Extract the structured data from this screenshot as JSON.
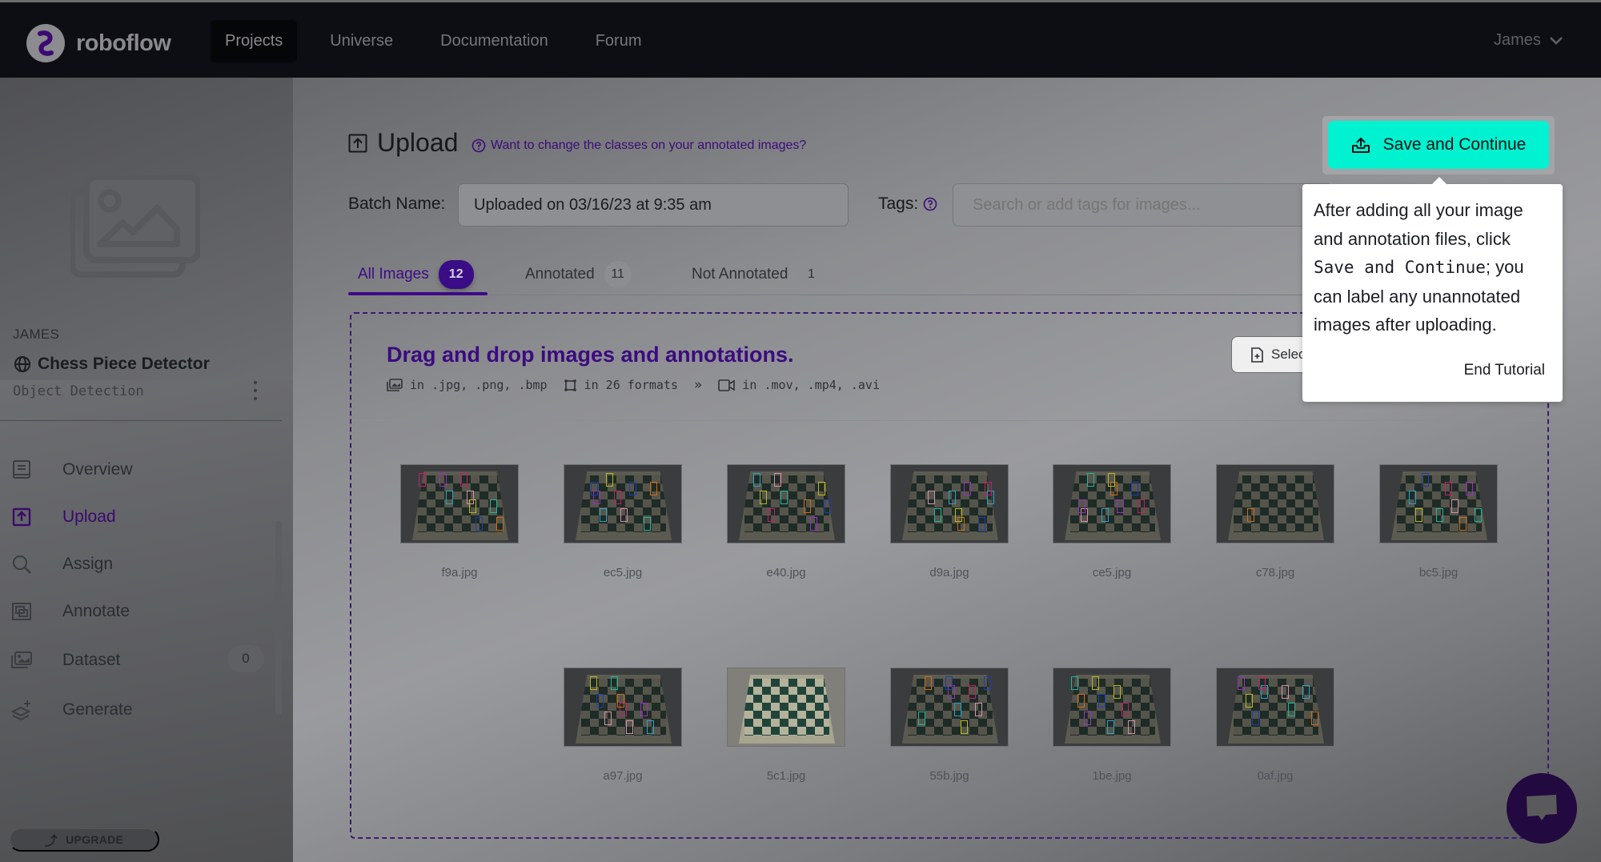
{
  "header": {
    "brand": "roboflow",
    "nav": [
      {
        "label": "Projects",
        "active": true
      },
      {
        "label": "Universe",
        "active": false
      },
      {
        "label": "Documentation",
        "active": false
      },
      {
        "label": "Forum",
        "active": false
      }
    ],
    "user": "James"
  },
  "sidebar": {
    "workspace": "JAMES",
    "project_name": "Chess Piece Detector",
    "project_type": "Object Detection",
    "items": [
      {
        "label": "Overview",
        "icon": "book-icon"
      },
      {
        "label": "Upload",
        "icon": "upload-icon",
        "active": true
      },
      {
        "label": "Assign",
        "icon": "search-icon"
      },
      {
        "label": "Annotate",
        "icon": "annotate-icon"
      },
      {
        "label": "Dataset",
        "icon": "images-icon",
        "count": "0"
      },
      {
        "label": "Generate",
        "icon": "layers-plus-icon"
      }
    ],
    "upgrade_label": "UPGRADE"
  },
  "main": {
    "title": "Upload",
    "help_link": "Want to change the classes on your annotated images?",
    "batch_label": "Batch Name:",
    "batch_value": "Uploaded on 03/16/23 at 9:35 am",
    "tags_label": "Tags:",
    "tags_placeholder": "Search or add tags for images...",
    "tabs": [
      {
        "label": "All Images",
        "count": "12",
        "active": true
      },
      {
        "label": "Annotated",
        "count": "11"
      },
      {
        "label": "Not Annotated",
        "count": "1"
      }
    ],
    "dropzone": {
      "title": "Drag and drop images and annotations.",
      "images_formats": "in .jpg, .png, .bmp",
      "annotation_formats": "in 26 formats",
      "more": "»",
      "video_formats": "in .mov, .mp4, .avi",
      "select_label": "Select Files"
    },
    "images": [
      {
        "name": "f9a.jpg"
      },
      {
        "name": "ec5.jpg"
      },
      {
        "name": "e40.jpg"
      },
      {
        "name": "d9a.jpg"
      },
      {
        "name": "ce5.jpg"
      },
      {
        "name": "c78.jpg"
      },
      {
        "name": "bc5.jpg"
      },
      {
        "name": "a97.jpg"
      },
      {
        "name": "5c1.jpg",
        "unannotated": true
      },
      {
        "name": "55b.jpg"
      },
      {
        "name": "1be.jpg"
      },
      {
        "name": "0af.jpg"
      }
    ]
  },
  "tutorial": {
    "save_button": "Save and Continue",
    "text_before": "After adding all your image and annotation files, click ",
    "text_code": "Save and Continue",
    "text_after": "; you can label any unannotated images after uploading.",
    "end_label": "End Tutorial"
  },
  "colors": {
    "accent": "#3c0a86",
    "save_button": "#00f2d0",
    "header_bg": "#0c0e13"
  }
}
